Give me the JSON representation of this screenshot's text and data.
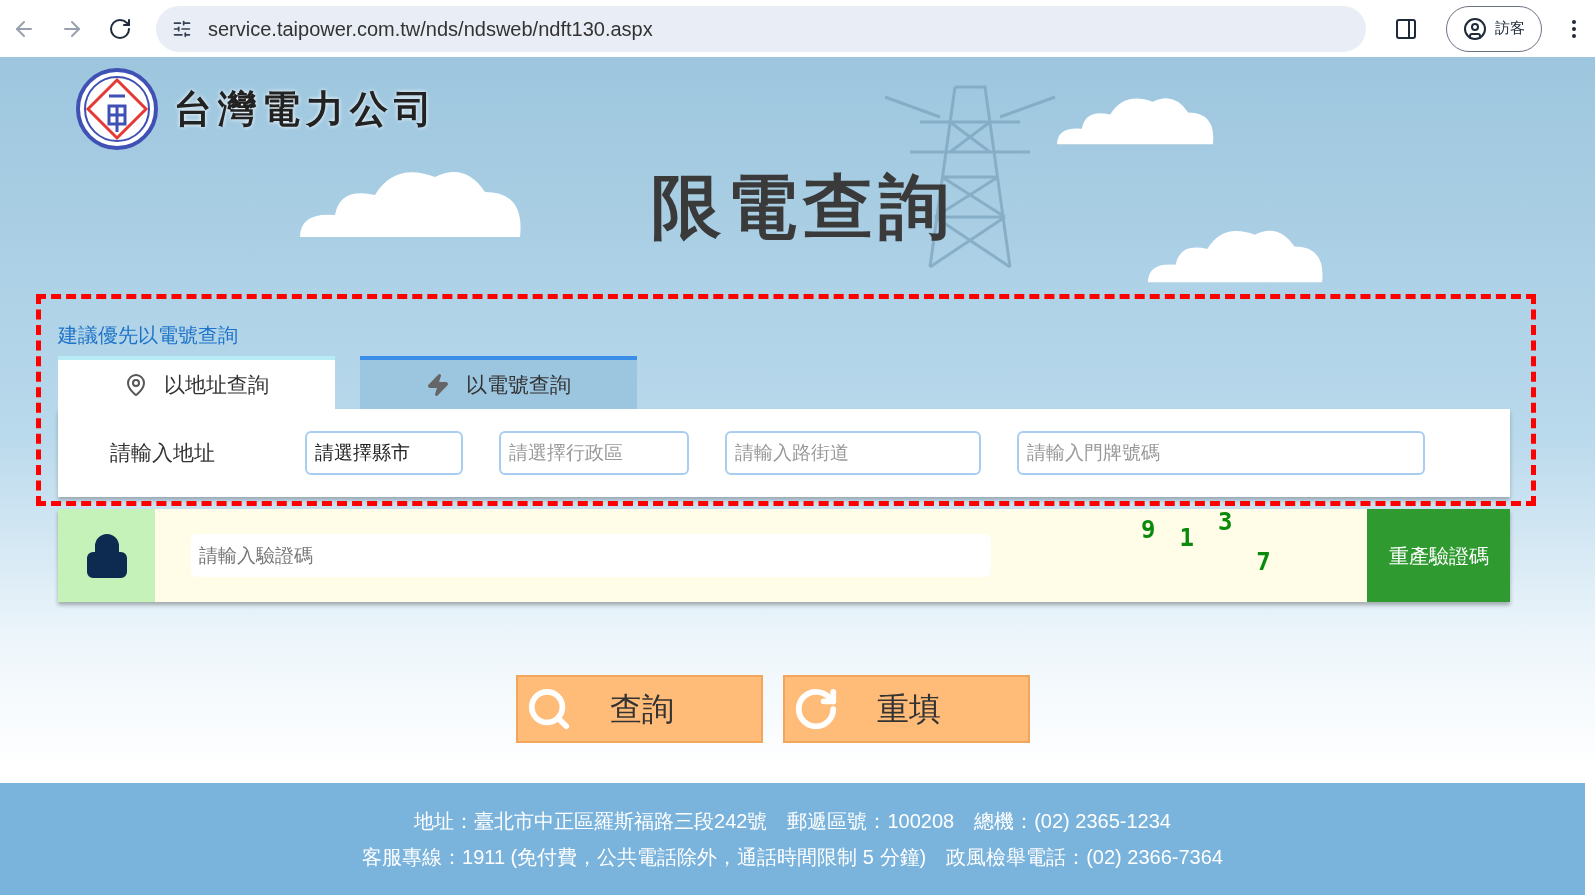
{
  "browser": {
    "url": "service.taipower.com.tw/nds/ndsweb/ndft130.aspx",
    "profile": "訪客"
  },
  "header": {
    "company": "台灣電力公司",
    "title": "限電查詢"
  },
  "hint": "建議優先以電號查詢",
  "tabs": [
    {
      "label": "以地址查詢",
      "selected": true,
      "kind": "pin"
    },
    {
      "label": "以電號查詢",
      "selected": false,
      "kind": "bolt"
    }
  ],
  "address_form": {
    "label": "請輸入地址",
    "fields": [
      {
        "value": "請選擇縣市"
      },
      {
        "placeholder": "請選擇行政區"
      },
      {
        "placeholder": "請輸入路街道"
      },
      {
        "placeholder": "請輸入門牌號碼"
      }
    ]
  },
  "captcha": {
    "placeholder": "請輸入驗證碼",
    "digits": [
      "9",
      "1",
      "3",
      "7"
    ],
    "refresh_button": "重產驗證碼"
  },
  "buttons": [
    {
      "label": "查詢",
      "kind": "search"
    },
    {
      "label": "重填",
      "kind": "reset"
    }
  ],
  "footer": [
    "地址：臺北市中正區羅斯福路三段242號　郵遞區號：100208　總機：(02) 2365-1234",
    "客服專線：1911 (免付費，公共電話除外，通話時間限制 5 分鐘)　政風檢舉電話：(02) 2366-7364"
  ]
}
